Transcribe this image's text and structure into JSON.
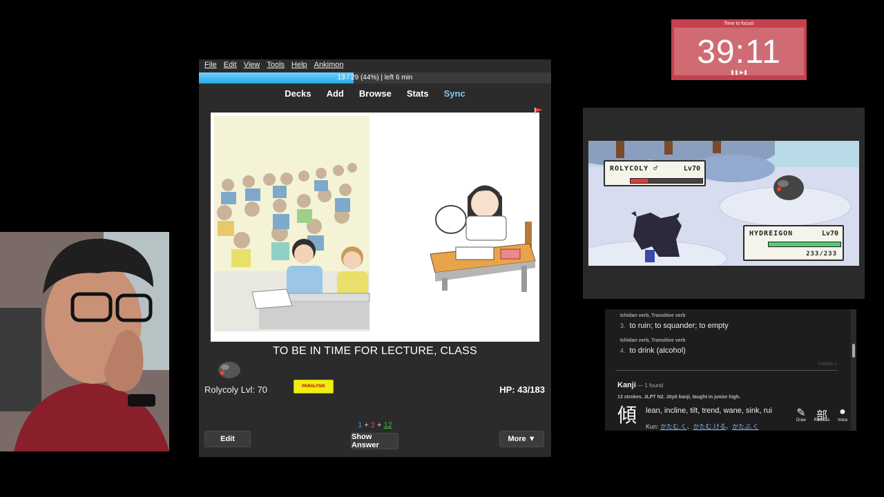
{
  "anki": {
    "menu": [
      "File",
      "Edit",
      "View",
      "Tools",
      "Help",
      "Ankimon"
    ],
    "progress_text": "13 / 29 (44%) | left 6 min",
    "progress_fraction": 0.44,
    "nav": {
      "decks": "Decks",
      "add": "Add",
      "browse": "Browse",
      "stats": "Stats",
      "sync": "Sync"
    },
    "card_text": "TO BE IN TIME FOR LECTURE, CLASS",
    "pokemon_name": "Rolycoly Lvl: 70",
    "status_badge": "PARALYSIS",
    "hp": "HP: 43/183",
    "counts": {
      "new": "1",
      "plus1": " + ",
      "learn": "2",
      "plus2": " + ",
      "review": "12"
    },
    "buttons": {
      "edit": "Edit",
      "show_answer": "Show Answer",
      "more": "More ▼"
    }
  },
  "timer": {
    "label": "Time to focus!",
    "time": "39:11",
    "controls": "❚❚ ▶❚"
  },
  "battle": {
    "enemy": {
      "name": "ROLYCOLY ♂",
      "level": "Lv70",
      "hp_fraction": 0.24
    },
    "player": {
      "name": "HYDREIGON",
      "level": "Lv70",
      "hp_text": "233/233",
      "hp_fraction": 1.0
    }
  },
  "dictionary": {
    "entries": [
      {
        "pos": "Ichidan verb, Transitive verb",
        "num": "3.",
        "def": "to ruin; to squander; to empty"
      },
      {
        "pos": "Ichidan verb, Transitive verb",
        "num": "4.",
        "def": "to drink (alcohol)"
      }
    ],
    "details_link": "Details »",
    "kanji_heading": "Kanji",
    "kanji_count": " — 1 found",
    "kanji_meta": "13 strokes. JLPT N2. Jōyō kanji, taught in junior high.",
    "kanji_char": "傾",
    "kanji_meaning": "lean, incline, tilt, trend, wane, sink, rui",
    "kun_label": "Kun: ",
    "kun_readings": [
      "かたむ.く",
      "かたむ.ける",
      "かたぶ.く"
    ],
    "tools": [
      {
        "icon": "✎",
        "label": "Draw",
        "name": "draw"
      },
      {
        "icon": "部",
        "label": "Radicals",
        "name": "radicals"
      },
      {
        "icon": "●",
        "label": "Voice",
        "name": "voice"
      }
    ]
  }
}
